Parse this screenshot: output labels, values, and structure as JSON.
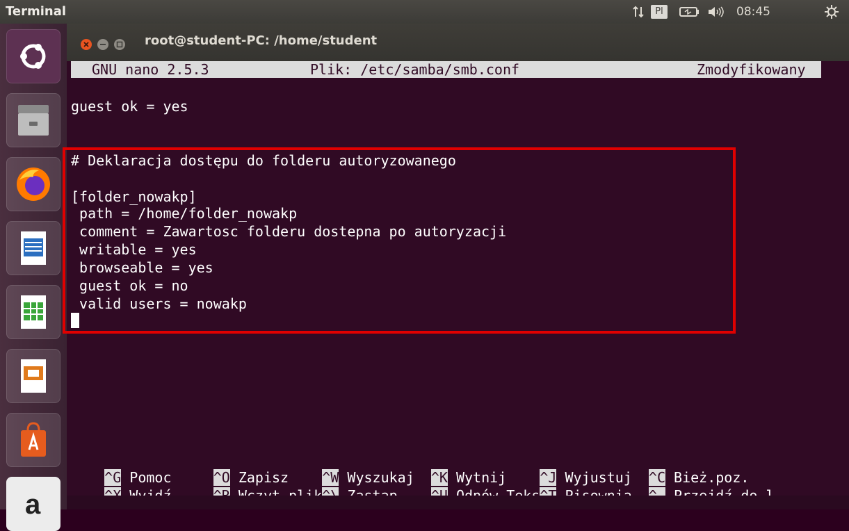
{
  "panel": {
    "title": "Terminal",
    "lang": "Pl",
    "time": "08:45"
  },
  "window": {
    "title": "root@student-PC: /home/student"
  },
  "nano": {
    "version": "GNU nano 2.5.3",
    "file": "Plik: /etc/samba/smb.conf",
    "status": "Zmodyfikowany"
  },
  "lines": [
    "guest ok = yes",
    "# Deklaracja dostępu do folderu autoryzowanego",
    "[folder_nowakp]",
    " path = /home/folder_nowakp",
    " comment = Zawartosc folderu dostepna po autoryzacji",
    " writable = yes",
    " browseable = yes",
    " guest ok = no",
    " valid users = nowakp"
  ],
  "shortcuts_row1": [
    {
      "key": "^G",
      "label": " Pomoc     "
    },
    {
      "key": "^O",
      "label": " Zapisz    "
    },
    {
      "key": "^W",
      "label": " Wyszukaj  "
    },
    {
      "key": "^K",
      "label": " Wytnij    "
    },
    {
      "key": "^J",
      "label": " Wyjustuj  "
    },
    {
      "key": "^C",
      "label": " Bież.poz."
    }
  ],
  "shortcuts_row2": [
    {
      "key": "^X",
      "label": " Wyjdź     "
    },
    {
      "key": "^R",
      "label": " Wczyt.plik"
    },
    {
      "key": "^\\",
      "label": " Zastąp    "
    },
    {
      "key": "^U",
      "label": " Odnów Teks"
    },
    {
      "key": "^T",
      "label": " Pisownia  "
    },
    {
      "key": "^_",
      "label": " Przejdź do l"
    }
  ]
}
